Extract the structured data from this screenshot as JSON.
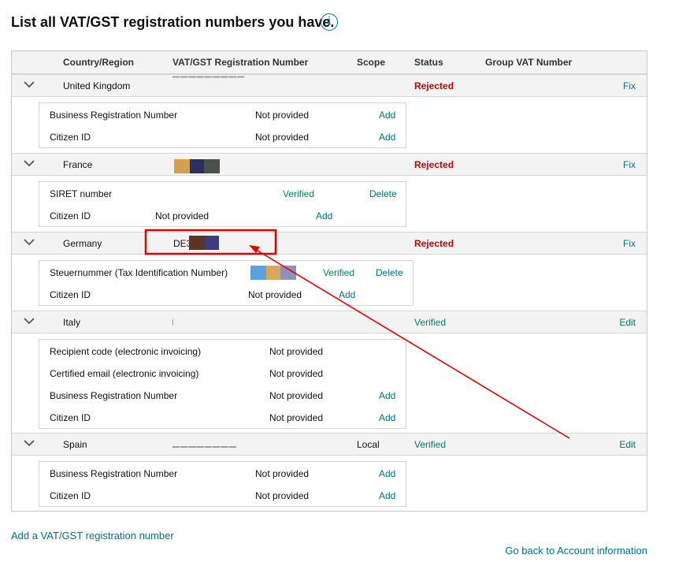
{
  "page": {
    "title": "List all VAT/GST registration numbers you have.",
    "info_icon": "i"
  },
  "table": {
    "headers": {
      "country": "Country/Region",
      "vat": "VAT/GST Registration Number",
      "scope": "Scope",
      "status": "Status",
      "group": "Group VAT Number"
    },
    "countries": [
      {
        "name": "United Kingdom",
        "vat": "",
        "scope": "",
        "status": "Rejected",
        "action": "Fix",
        "details": [
          {
            "label": "Business Registration Number",
            "value": "Not provided",
            "action": "Add"
          },
          {
            "label": "Citizen ID",
            "value": "Not provided",
            "action": "Add"
          }
        ]
      },
      {
        "name": "France",
        "vat": "",
        "scope": "",
        "status": "Rejected",
        "action": "Fix",
        "details": [
          {
            "label": "SIRET number",
            "value": "Verified",
            "action": "Delete"
          },
          {
            "label": "Citizen ID",
            "value": "Not provided",
            "action": "Add"
          }
        ]
      },
      {
        "name": "Germany",
        "vat": "DE3",
        "scope": "",
        "status": "Rejected",
        "action": "Fix",
        "details": [
          {
            "label": "Steuernummer (Tax Identification Number)",
            "value": "Verified",
            "action": "Delete"
          },
          {
            "label": "Citizen ID",
            "value": "Not provided",
            "action": "Add"
          }
        ]
      },
      {
        "name": "Italy",
        "vat": "",
        "scope": "",
        "status": "Verified",
        "action": "Edit",
        "details": [
          {
            "label": "Recipient code (electronic invoicing)",
            "value": "Not provided",
            "action": ""
          },
          {
            "label": "Certified email (electronic invoicing)",
            "value": "Not provided",
            "action": ""
          },
          {
            "label": "Business Registration Number",
            "value": "Not provided",
            "action": "Add"
          },
          {
            "label": "Citizen ID",
            "value": "Not provided",
            "action": "Add"
          }
        ]
      },
      {
        "name": "Spain",
        "vat": "",
        "scope": "Local",
        "status": "Verified",
        "action": "Edit",
        "details": [
          {
            "label": "Business Registration Number",
            "value": "Not provided",
            "action": "Add"
          },
          {
            "label": "Citizen ID",
            "value": "Not provided",
            "action": "Add"
          }
        ]
      }
    ]
  },
  "footer": {
    "add_link": "Add a VAT/GST registration number",
    "back_link": "Go back to Account information"
  },
  "colors": {
    "rejected": "#c40000",
    "verified": "#067d62",
    "link": "#007185",
    "annotation": "#e00000"
  }
}
